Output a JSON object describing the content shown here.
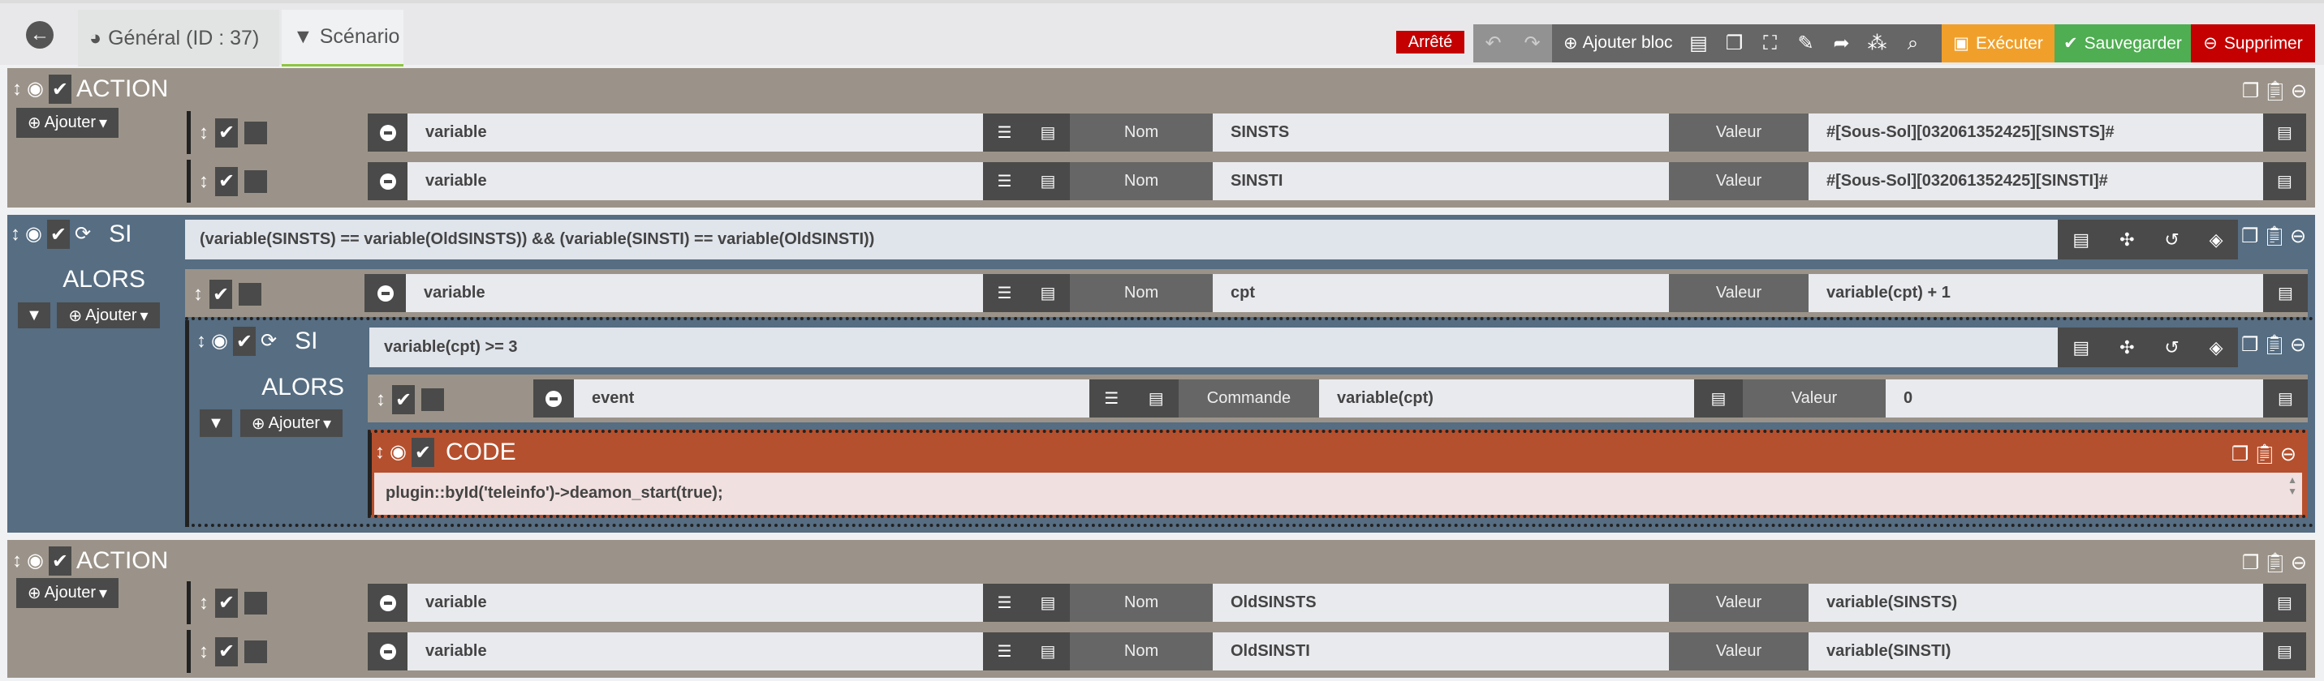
{
  "header": {
    "tabs": [
      {
        "label": "Général (ID : 37)"
      },
      {
        "label": "Scénario"
      }
    ],
    "status": "Arrêté",
    "toolbar": {
      "add_block": "Ajouter bloc",
      "execute": "Exécuter",
      "save": "Sauvegarder",
      "delete": "Supprimer"
    },
    "colors": {
      "execute": "#f0a02a",
      "save": "#4fad52",
      "delete": "#c40000",
      "status": "#c40000"
    }
  },
  "action1": {
    "title": "ACTION",
    "add": "Ajouter",
    "rows": [
      {
        "type": "variable",
        "name_label": "Nom",
        "name": "SINSTS",
        "value_label": "Valeur",
        "value": "#[Sous-Sol][032061352425][SINSTS]#"
      },
      {
        "type": "variable",
        "name_label": "Nom",
        "name": "SINSTI",
        "value_label": "Valeur",
        "value": "#[Sous-Sol][032061352425][SINSTI]#"
      }
    ]
  },
  "si1": {
    "title": "SI",
    "condition": "(variable(SINSTS) == variable(OldSINSTS)) && (variable(SINSTI) == variable(OldSINSTI))",
    "then": "ALORS",
    "add": "Ajouter",
    "row": {
      "type": "variable",
      "name_label": "Nom",
      "name": "cpt",
      "value_label": "Valeur",
      "value": "variable(cpt) + 1"
    },
    "si2": {
      "title": "SI",
      "condition": "variable(cpt) >= 3",
      "then": "ALORS",
      "add": "Ajouter",
      "row": {
        "type": "event",
        "cmd_label": "Commande",
        "cmd": "variable(cpt)",
        "value_label": "Valeur",
        "value": "0"
      },
      "code": {
        "title": "CODE",
        "text": "plugin::byId('teleinfo')->deamon_start(true);"
      }
    }
  },
  "action2": {
    "title": "ACTION",
    "add": "Ajouter",
    "rows": [
      {
        "type": "variable",
        "name_label": "Nom",
        "name": "OldSINSTS",
        "value_label": "Valeur",
        "value": "variable(SINSTS)"
      },
      {
        "type": "variable",
        "name_label": "Nom",
        "name": "OldSINSTI",
        "value_label": "Valeur",
        "value": "variable(SINSTI)"
      }
    ]
  }
}
